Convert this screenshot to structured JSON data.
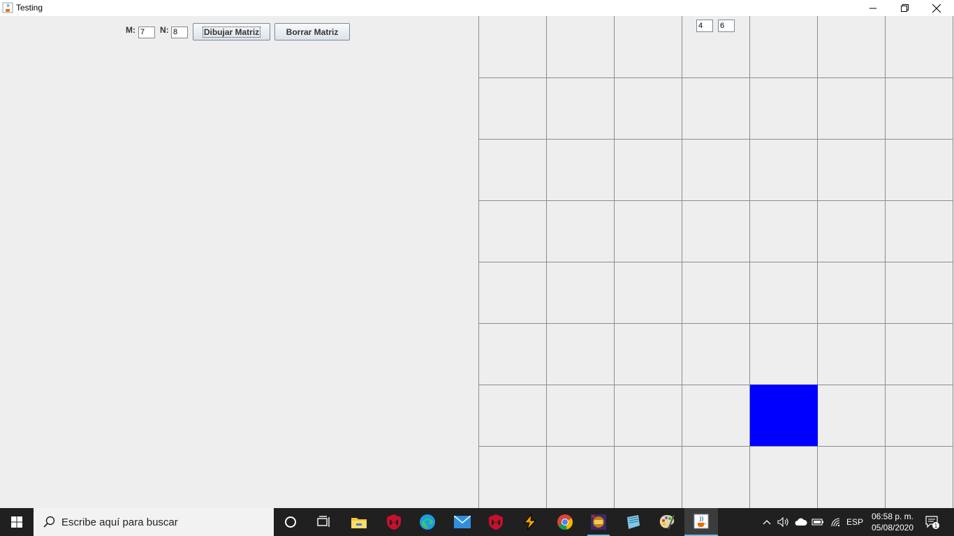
{
  "window": {
    "title": "Testing"
  },
  "controls": {
    "m_label": "M:",
    "m_value": "7",
    "n_label": "N:",
    "n_value": "8",
    "draw_button": "Dibujar Matriz",
    "clear_button": "Borrar Matriz"
  },
  "grid": {
    "columns": 7,
    "rows": 8,
    "coord_x": "4",
    "coord_y": "6",
    "highlight_color": "#0000ff",
    "line_color": "#8c8c8c",
    "highlighted_cell": {
      "column": 5,
      "row": 7
    }
  },
  "taskbar": {
    "search_placeholder": "Escribe aquí para buscar",
    "language": "ESP",
    "time": "06:58 p. m.",
    "date": "05/08/2020",
    "notification_count": "1",
    "apps": [
      "cortana-icon",
      "task-view-icon",
      "file-explorer-icon",
      "mcafee-icon",
      "edge-icon",
      "mail-icon",
      "mcafee-icon",
      "winamp-icon",
      "chrome-icon",
      "game-icon",
      "notepad-icon",
      "paint-icon",
      "java-icon"
    ]
  }
}
